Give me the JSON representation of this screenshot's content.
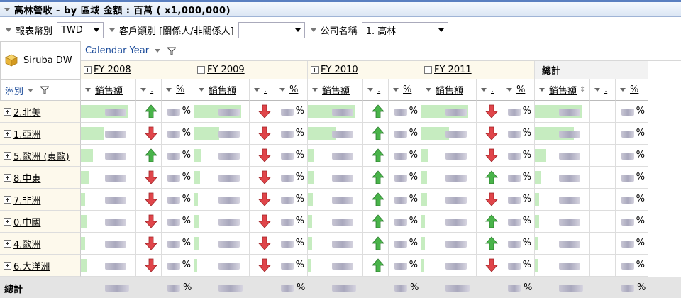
{
  "window": {
    "title": "高林營收 - by 區域 金額 : 百萬 ( x1,000,000)"
  },
  "filters": [
    {
      "label": "報表幣別",
      "value": "TWD"
    },
    {
      "label": "客戶類別 [關係人/非關係人]",
      "value": ""
    },
    {
      "label": "公司名稱",
      "value": "1. 高林"
    }
  ],
  "pivot": {
    "cube_label": "Siruba DW",
    "column_dimension": "Calendar Year",
    "row_dimension": "洲別",
    "years": [
      "FY 2008",
      "FY 2009",
      "FY 2010",
      "FY 2011"
    ],
    "total_label": "總計",
    "measure_headers": {
      "sales": "銷售額",
      "dot": ".",
      "pct": "%"
    },
    "rows": [
      {
        "label": "2.北美",
        "bars": [
          0.85,
          0.85,
          0.85,
          0.85,
          0.85
        ],
        "arrows": [
          "up",
          "down",
          "up",
          "down"
        ]
      },
      {
        "label": "1.亞洲",
        "bars": [
          0.42,
          0.45,
          0.5,
          0.5,
          0.7
        ],
        "arrows": [
          "down",
          "down",
          "up",
          "down"
        ]
      },
      {
        "label": "5.歐洲 (東歐)",
        "bars": [
          0.22,
          0.12,
          0.12,
          0.12,
          0.2
        ],
        "arrows": [
          "up",
          "down",
          "up",
          "down"
        ]
      },
      {
        "label": "8.中東",
        "bars": [
          0.14,
          0.1,
          0.1,
          0.1,
          0.1
        ],
        "arrows": [
          "down",
          "down",
          "up",
          "up"
        ]
      },
      {
        "label": "7.非洲",
        "bars": [
          0.08,
          0.07,
          0.09,
          0.1,
          0.08
        ],
        "arrows": [
          "down",
          "down",
          "up",
          "down"
        ]
      },
      {
        "label": "0.中國",
        "bars": [
          0.1,
          0.08,
          0.08,
          0.07,
          0.08
        ],
        "arrows": [
          "down",
          "down",
          "up",
          "up"
        ]
      },
      {
        "label": "4.歐洲",
        "bars": [
          0.08,
          0.08,
          0.08,
          0.06,
          0.06
        ],
        "arrows": [
          "down",
          "down",
          "up",
          "up"
        ]
      },
      {
        "label": "6.大洋洲",
        "bars": [
          0.1,
          0.05,
          0.05,
          0.05,
          0.05
        ],
        "arrows": [
          "down",
          "down",
          "up",
          "down"
        ]
      }
    ],
    "grand_total_label": "總計"
  },
  "colors": {
    "bar": "#c6ecc0",
    "up_arrow": "#49b44a",
    "down_arrow": "#e0454a",
    "header_bg": "#fdf9ec"
  }
}
